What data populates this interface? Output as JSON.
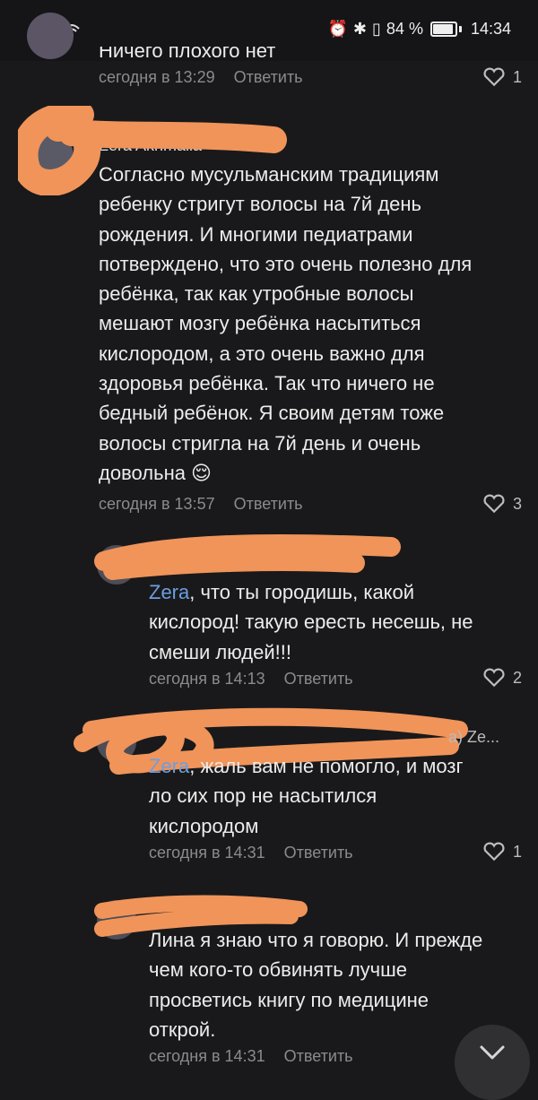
{
  "status_bar": {
    "signal": "…⧫📶",
    "icons": "⏰ ✱ ⎕",
    "battery": "84 %",
    "time": "14:34"
  },
  "comments": [
    {
      "text": "Ничего плохого нет",
      "time": "сегодня в 13:29",
      "reply": "Ответить",
      "likes": "1"
    },
    {
      "author": "Zera Akhmaliа",
      "text": "Согласно мусульманским традициям ребенку стригут волосы на 7й день рождения.  И многими педиатрами потверждено,  что это очень полезно для ребёнка, так как утробные волосы мешают мозгу ребёнка насытиться кислородом,  а это очень важно для здоровья ребёнка. Так что ничего не бедный ребёнок.  Я своим детям тоже волосы стригла на 7й день и очень довольна 😌",
      "time": "сегодня в 13:57",
      "reply": "Ответить",
      "likes": "3"
    },
    {
      "mention": "Zera",
      "text": ", что ты городишь, какой кислород! такую ересть несешь, не смеши людей!!!",
      "time": "сегодня в 14:13",
      "reply": "Ответить",
      "likes": "2"
    },
    {
      "author_suffix": "a)  Ze...",
      "mention": "Zera",
      "text": ", жаль вам не помогло, и мозг ло сих пор не насытился кислородом",
      "time": "сегодня в 14:31",
      "reply": "Ответить",
      "likes": "1"
    },
    {
      "text": "Лина я знаю что я говорю.  И прежде чем кого-то обвинять лучше просветись книгу по медицине открой.",
      "time": "сегодня в 14:31",
      "reply": "Ответить"
    }
  ]
}
